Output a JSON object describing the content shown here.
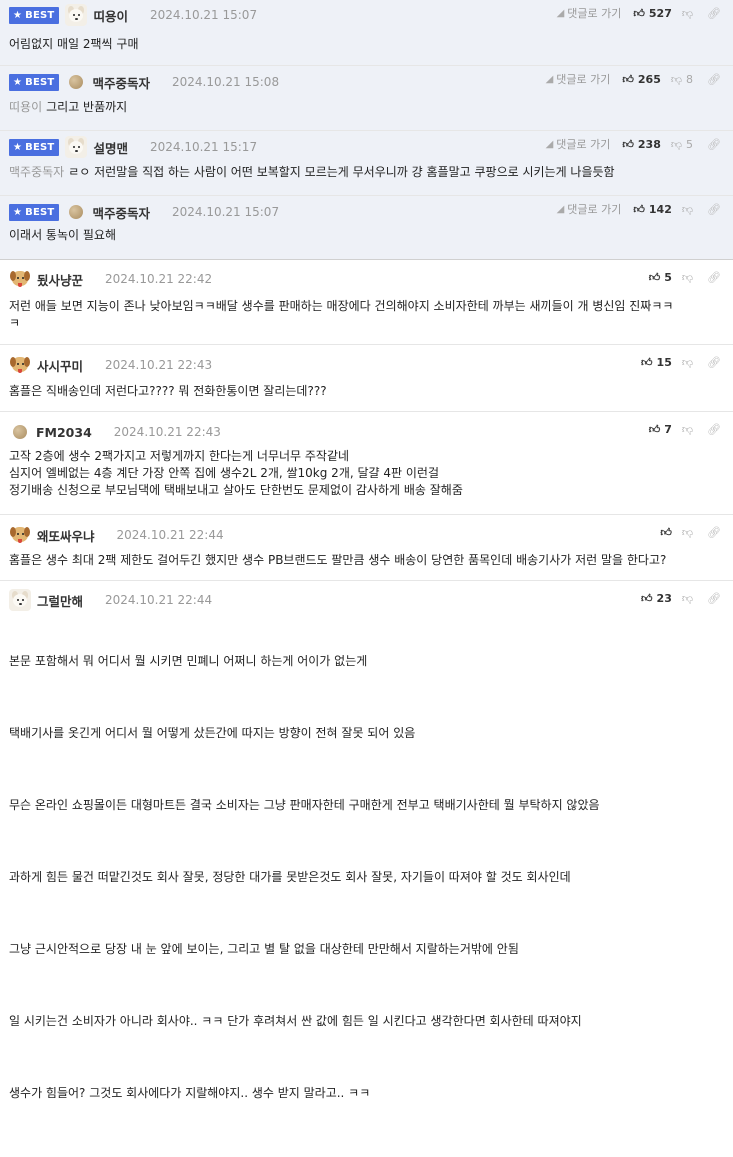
{
  "best_label": "BEST",
  "reply_label": "댓글로 가기",
  "best_comments": [
    {
      "nick": "띠용이",
      "date": "2024.10.21 15:07",
      "up": "527",
      "down": "",
      "ref": "",
      "text": "어림없지 매일 2팩씩 구매",
      "avatar": "dog"
    },
    {
      "nick": "맥주중독자",
      "date": "2024.10.21 15:08",
      "up": "265",
      "down": "8",
      "ref": "띠용이",
      "text": "그리고 반품까지",
      "avatar": "ball"
    },
    {
      "nick": "설명맨",
      "date": "2024.10.21 15:17",
      "up": "238",
      "down": "5",
      "ref": "맥주중독자",
      "text": "ㄹㅇ 저런말을 직접 하는 사람이 어떤 보복할지 모르는게 무서우니까 걍 홈플말고 쿠팡으로 시키는게 나을듯함",
      "avatar": "dog"
    },
    {
      "nick": "맥주중독자",
      "date": "2024.10.21 15:07",
      "up": "142",
      "down": "",
      "ref": "",
      "text": "이래서 통녹이 필요해",
      "avatar": "ball"
    }
  ],
  "comments": [
    {
      "nick": "됬사냥꾼",
      "date": "2024.10.21 22:42",
      "up": "5",
      "text": "저런 애들 보면 지능이 존나 낮아보임ㅋㅋ배달 생수를 판매하는 매장에다 건의해야지 소비자한테 까부는 새끼들이 개 병신임 진짜ㅋㅋ\nㅋ",
      "avatar": "pup"
    },
    {
      "nick": "사시꾸미",
      "date": "2024.10.21 22:43",
      "up": "15",
      "text": "홈플은 직배송인데 저런다고???? 뭐 전화한통이면 잘리는데???",
      "avatar": "pup"
    },
    {
      "nick": "FM2034",
      "date": "2024.10.21 22:43",
      "up": "7",
      "text": "고작 2층에 생수 2팩가지고 저렇게까지 한다는게 너무너무 주작같네\n심지어 엘베없는 4층 계단 가장 안쪽 집에 생수2L 2개, 쌀10kg 2개, 달걀 4판 이런걸\n정기배송 신청으로 부모님댁에 택배보내고 살아도 단한번도 문제없이 감사하게 배송 잘해줌",
      "avatar": "ball"
    },
    {
      "nick": "왜또싸우냐",
      "date": "2024.10.21 22:44",
      "up": "",
      "text": "홈플은 생수 최대 2팩 제한도 걸어두긴 했지만 생수 PB브랜드도 팔만큼 생수 배송이 당연한 품목인데 배송기사가 저런 말을 한다고?",
      "avatar": "pup"
    },
    {
      "nick": "그럴만해",
      "date": "2024.10.21 22:44",
      "up": "23",
      "paragraphs": [
        "본문 포함해서 뭐 어디서 뭘 시키면 민폐니 어쩌니 하는게 어이가 없는게",
        "택배기사를 옷긴게 어디서 뭘 어떻게 샀든간에 따지는 방향이 전혀 잘못 되어 있음",
        "무슨 온라인 쇼핑몰이든 대형마트든 결국 소비자는 그냥 판매자한테 구매한게 전부고 택배기사한테 뭘 부탁하지 않았음",
        "과하게 힘든 물건 떠맡긴것도 회사 잘못, 정당한 대가를 못받은것도 회사 잘못, 자기들이 따져야 할 것도 회사인데",
        "그냥 근시안적으로 당장 내 눈 앞에 보이는, 그리고 별 탈 없을 대상한테 만만해서 지랄하는거밖에 안됨",
        "일 시키는건 소비자가 아니라 회사야.. ㅋㅋ 단가 후려쳐서 싼 값에 힘든 일 시킨다고 생각한다면 회사한테 따져야지",
        "생수가 힘들어? 그것도 회사에다가 지랄해야지.. 생수 받지 말라고.. ㅋㅋ"
      ],
      "avatar": "dog"
    }
  ]
}
